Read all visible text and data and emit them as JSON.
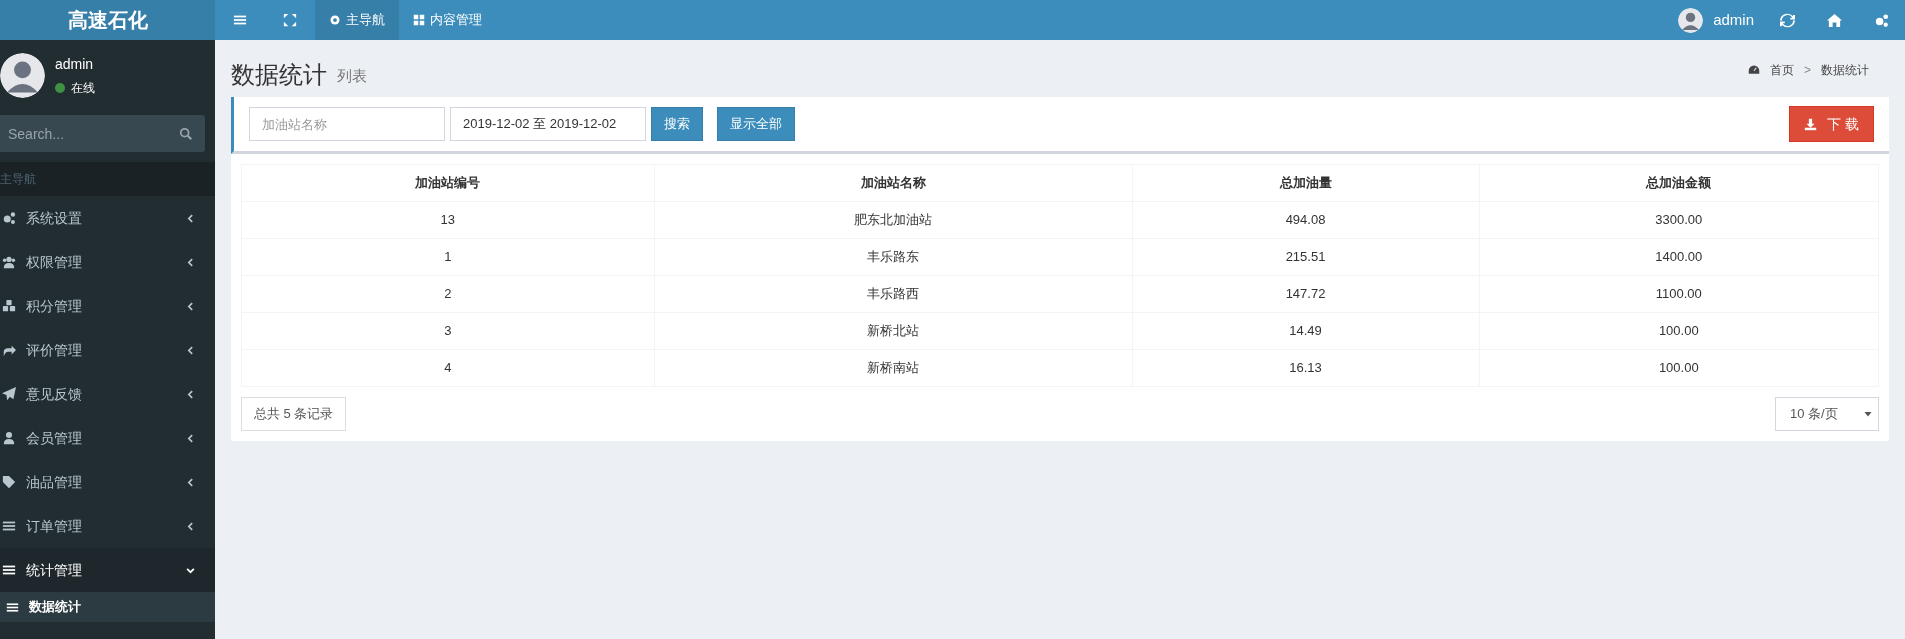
{
  "header": {
    "brand": "高速石化",
    "tabs": [
      {
        "label": "主导航",
        "selected": true
      },
      {
        "label": "内容管理",
        "selected": false
      }
    ],
    "user": {
      "name": "admin"
    }
  },
  "sidebar": {
    "user": {
      "name": "admin",
      "status": "在线",
      "online": true
    },
    "search": {
      "placeholder": "Search..."
    },
    "section_header": "主导航",
    "items": [
      {
        "label": "系统设置",
        "expanded": false
      },
      {
        "label": "权限管理",
        "expanded": false
      },
      {
        "label": "积分管理",
        "expanded": false
      },
      {
        "label": "评价管理",
        "expanded": false
      },
      {
        "label": "意见反馈",
        "expanded": false
      },
      {
        "label": "会员管理",
        "expanded": false
      },
      {
        "label": "油品管理",
        "expanded": false
      },
      {
        "label": "订单管理",
        "expanded": false
      },
      {
        "label": "统计管理",
        "expanded": true,
        "children": [
          {
            "label": "数据统计",
            "selected": true
          }
        ]
      }
    ]
  },
  "content": {
    "title": "数据统计",
    "subtitle": "列表",
    "breadcrumb": {
      "items": [
        "首页",
        "数据统计"
      ],
      "separator": ">"
    },
    "filter": {
      "name_field": {
        "placeholder": "加油站名称"
      },
      "date_field": {
        "value": "2019-12-02 至 2019-12-02"
      },
      "search_button": "搜索",
      "show_all_button": "显示全部",
      "download_button": "下 载"
    },
    "table": {
      "columns": [
        "加油站编号",
        "加油站名称",
        "总加油量",
        "总加油金额"
      ],
      "rows": [
        [
          "13",
          "肥东北加油站",
          "494.08",
          "3300.00"
        ],
        [
          "1",
          "丰乐路东",
          "215.51",
          "1400.00"
        ],
        [
          "2",
          "丰乐路西",
          "147.72",
          "1100.00"
        ],
        [
          "3",
          "新桥北站",
          "14.49",
          "100.00"
        ],
        [
          "4",
          "新桥南站",
          "16.13",
          "100.00"
        ]
      ]
    },
    "total": "总共 5 条记录",
    "page_size": "10 条/页"
  }
}
